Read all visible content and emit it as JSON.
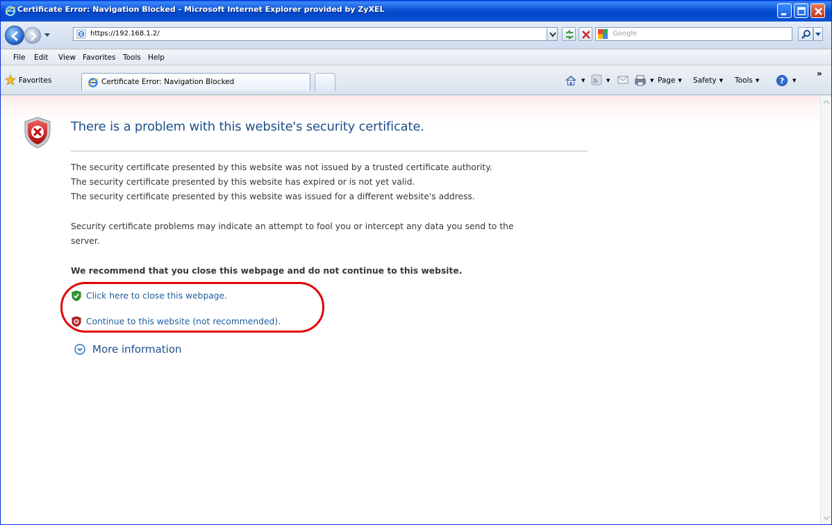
{
  "window": {
    "title": "Certificate Error: Navigation Blocked - Microsoft Internet Explorer provided by ZyXEL"
  },
  "address_bar": {
    "url": "https://192.168.1.2/",
    "search_placeholder": "Google"
  },
  "menu": {
    "items": [
      "File",
      "Edit",
      "View",
      "Favorites",
      "Tools",
      "Help"
    ]
  },
  "toolbar": {
    "favorites_label": "Favorites",
    "active_tab_title": "Certificate Error: Navigation Blocked",
    "page_label": "Page",
    "safety_label": "Safety",
    "tools_label": "Tools",
    "overflow_label": "»"
  },
  "error_page": {
    "heading": "There is a problem with this website's security certificate.",
    "reasons": [
      "The security certificate presented by this website was not issued by a trusted certificate authority.",
      "The security certificate presented by this website has expired or is not yet valid.",
      "The security certificate presented by this website was issued for a different website's address."
    ],
    "warning_line1": "Security certificate problems may indicate an attempt to fool you or intercept any data you send to the",
    "warning_line2": "server.",
    "recommendation": "We recommend that you close this webpage and do not continue to this website.",
    "close_link": "Click here to close this webpage.",
    "continue_link": "Continue to this website (not recommended).",
    "more_info": "More information"
  },
  "colors": {
    "heading_blue": "#1f4f8c",
    "link_blue": "#1e5c9e",
    "highlight_red": "#e00000",
    "titlebar_blue": "#0a52d6"
  },
  "icons": {
    "error": "shield-error-icon",
    "safe": "shield-check-icon",
    "unsafe": "shield-x-icon",
    "expand": "chevron-down-circle-icon"
  }
}
